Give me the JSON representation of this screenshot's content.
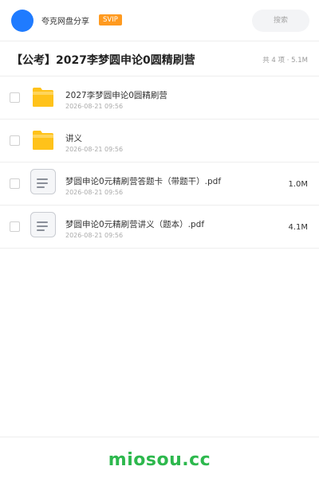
{
  "header": {
    "brand": "夸克网盘分享",
    "badge": "SVIP",
    "search_placeholder": "搜索"
  },
  "share": {
    "title": "【公考】2027李梦圆申论0圆精刷营",
    "summary": "共 4 项 · 5.1M"
  },
  "files": [
    {
      "type": "folder",
      "name": "2027李梦圆申论0圆精刷营",
      "date": "2026-08-21 09:56",
      "size": ""
    },
    {
      "type": "folder",
      "name": "讲义",
      "date": "2026-08-21 09:56",
      "size": ""
    },
    {
      "type": "pdf",
      "name": "梦圆申论0元精刷营答题卡（带题干）.pdf",
      "date": "2026-08-21 09:56",
      "size": "1.0M"
    },
    {
      "type": "pdf",
      "name": "梦圆申论0元精刷营讲义（题本）.pdf",
      "date": "2026-08-21 09:56",
      "size": "4.1M"
    }
  ],
  "footer": {
    "brand": "miosou.cc"
  },
  "colors": {
    "avatar": "#1f7bff",
    "badge": "#ff9a1f",
    "folder": "#ffc21a",
    "footer_brand": "#2db84d"
  }
}
